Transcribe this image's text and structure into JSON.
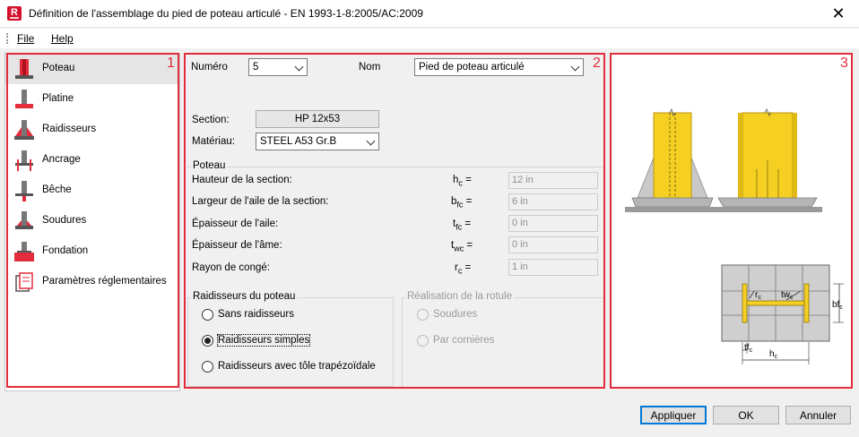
{
  "window": {
    "title": "Définition de l'assemblage du pied de poteau articulé - EN 1993-1-8:2005/AC:2009",
    "app_icon_letter": "R",
    "close_glyph": "✕"
  },
  "menu": {
    "file": "File",
    "help": "Help"
  },
  "sidebar": {
    "items": [
      {
        "label": "Poteau",
        "icon": "column-icon"
      },
      {
        "label": "Platine",
        "icon": "base-plate-icon"
      },
      {
        "label": "Raidisseurs",
        "icon": "stiffeners-icon"
      },
      {
        "label": "Ancrage",
        "icon": "anchorage-icon"
      },
      {
        "label": "Bêche",
        "icon": "shear-key-icon"
      },
      {
        "label": "Soudures",
        "icon": "welds-icon"
      },
      {
        "label": "Fondation",
        "icon": "foundation-icon"
      },
      {
        "label": "Paramètres réglementaires",
        "icon": "code-parameters-icon"
      }
    ],
    "selected": 0
  },
  "frame_numbers": {
    "one": "1",
    "two": "2",
    "three": "3"
  },
  "form": {
    "numero_label": "Numéro",
    "numero_value": "5",
    "nom_label": "Nom",
    "nom_value": "Pied de poteau articulé",
    "section_label": "Section:",
    "section_value": "HP 12x53",
    "material_label": "Matériau:",
    "material_value": "STEEL A53 Gr.B",
    "poteau_group": "Poteau",
    "fields": [
      {
        "label": "Hauteur de la section:",
        "sym": "h",
        "sub": "c",
        "value": "12 in"
      },
      {
        "label": "Largeur de l'aile de la section:",
        "sym": "b",
        "sub": "fc",
        "value": "6 in"
      },
      {
        "label": "Épaisseur de l'aile:",
        "sym": "t",
        "sub": "fc",
        "value": "0 in"
      },
      {
        "label": "Épaisseur de l'âme:",
        "sym": "t",
        "sub": "wc",
        "value": "0 in"
      },
      {
        "label": "Rayon de congé:",
        "sym": "r",
        "sub": "c",
        "value": "1 in"
      }
    ],
    "equals": "=",
    "stiffeners_group": "Raidisseurs du poteau",
    "stiffener_options": [
      "Sans raidisseurs",
      "Raidisseurs simples",
      "Raidisseurs avec tôle trapézoïdale"
    ],
    "stiffener_selected": 1,
    "hinge_group": "Réalisation de la rotule",
    "hinge_options": [
      "Soudures",
      "Par cornières"
    ]
  },
  "diagram": {
    "rc": "r",
    "rc_sub": "c",
    "twc": "tw",
    "twc_sub": "c",
    "bfc": "bf",
    "bfc_sub": "c",
    "tfc": "tf",
    "tfc_sub": "c",
    "hc": "h",
    "hc_sub": "c"
  },
  "buttons": {
    "apply": "Appliquer",
    "ok": "OK",
    "cancel": "Annuler"
  },
  "colors": {
    "accent_red": "#e22d3c",
    "column_yellow": "#f5d022",
    "plate_gray": "#b5b5b5"
  }
}
